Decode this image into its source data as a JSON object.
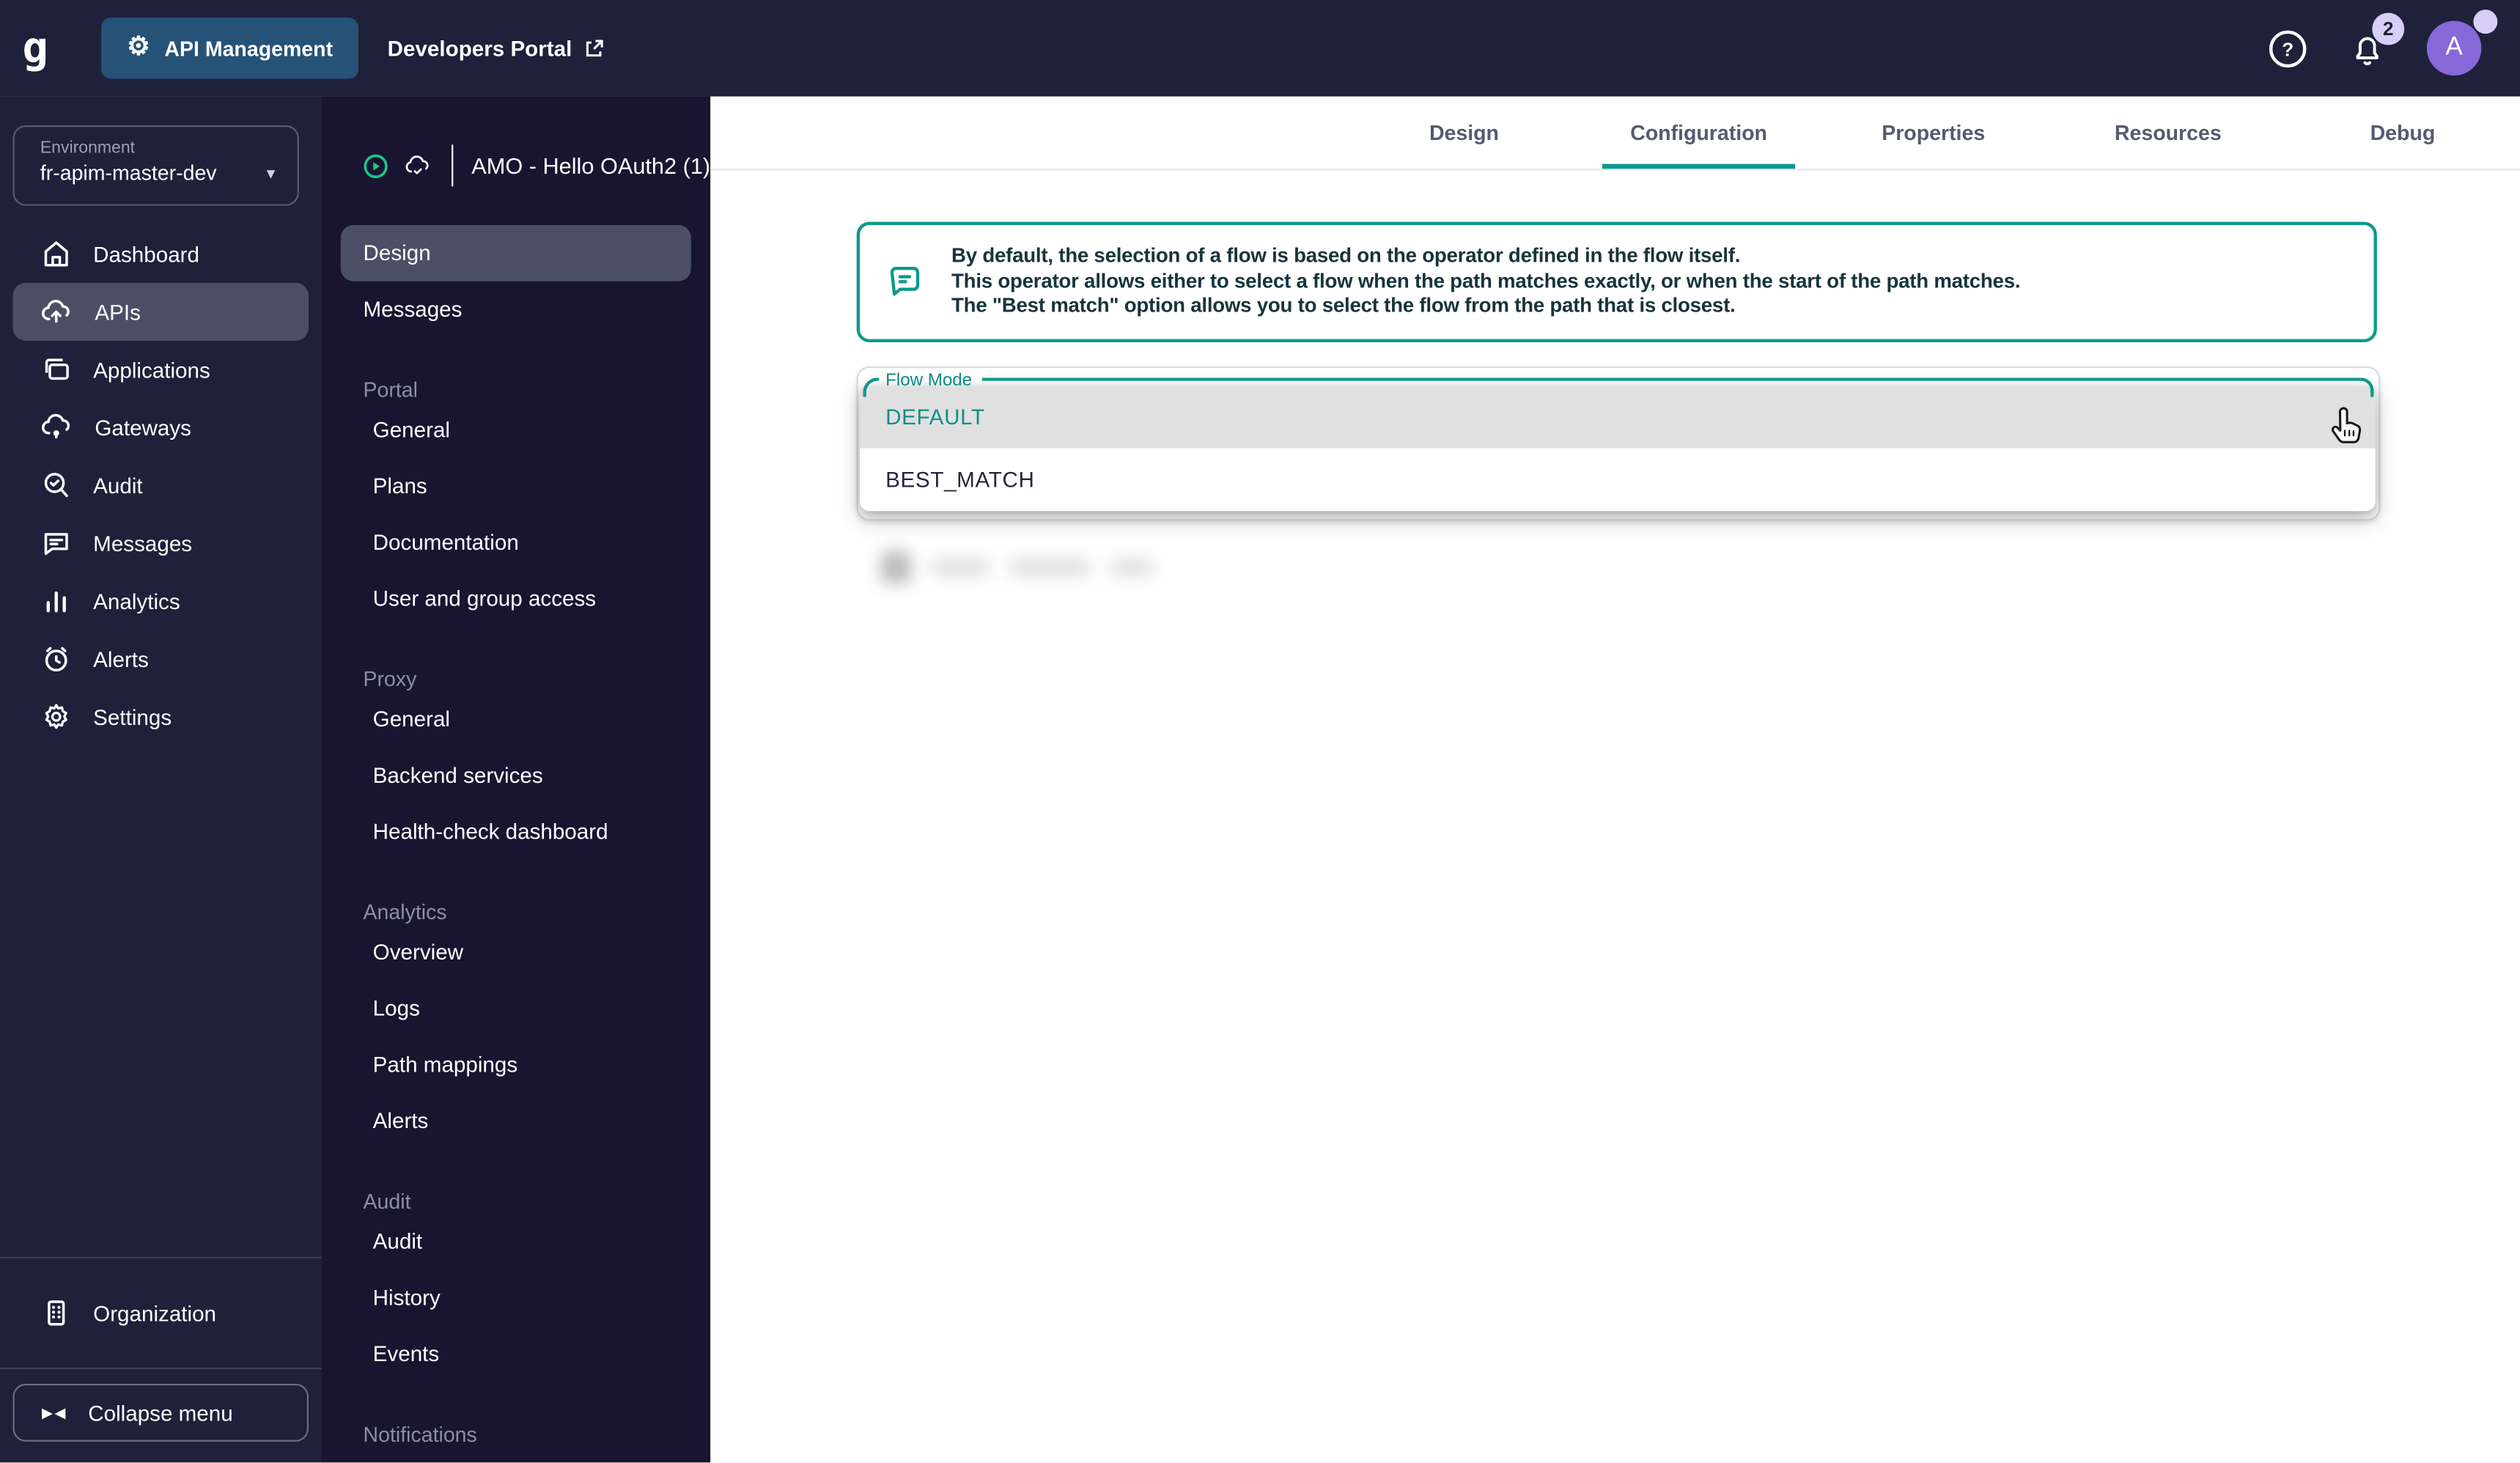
{
  "colors": {
    "accent": "#0c9a8d",
    "topbar_bg": "#1e2139",
    "sidenav_bg": "#191530",
    "selected_bg": "#4b4f66",
    "app_button_bg": "#265278",
    "avatar_bg": "#8668d9",
    "badge_bg": "#d8cff8",
    "option_highlight_bg": "#e0e0e0"
  },
  "topbar": {
    "logo": "g",
    "app_button": "API Management",
    "portal_link": "Developers Portal",
    "help_glyph": "?",
    "notifications_count": "2",
    "avatar_letter": "A"
  },
  "environment": {
    "label": "Environment",
    "value": "fr-apim-master-dev"
  },
  "sidebar": {
    "items": [
      {
        "label": "Dashboard",
        "icon": "home"
      },
      {
        "label": "APIs",
        "icon": "cloud-up",
        "selected": true
      },
      {
        "label": "Applications",
        "icon": "applications"
      },
      {
        "label": "Gateways",
        "icon": "cloud-gateway"
      },
      {
        "label": "Audit",
        "icon": "magnifier-check"
      },
      {
        "label": "Messages",
        "icon": "chat"
      },
      {
        "label": "Analytics",
        "icon": "bar-chart"
      },
      {
        "label": "Alerts",
        "icon": "alarm"
      },
      {
        "label": "Settings",
        "icon": "gear"
      }
    ],
    "organization": "Organization",
    "collapse": "Collapse menu",
    "collapse_glyph": "▶◀"
  },
  "api_menu": {
    "title": "AMO - Hello OAuth2 (1)",
    "items": [
      {
        "label": "Design",
        "selected": true
      },
      {
        "label": "Messages"
      }
    ],
    "sections": [
      {
        "header": "Portal",
        "items": [
          "General",
          "Plans",
          "Documentation",
          "User and group access"
        ]
      },
      {
        "header": "Proxy",
        "items": [
          "General",
          "Backend services",
          "Health-check dashboard"
        ]
      },
      {
        "header": "Analytics",
        "items": [
          "Overview",
          "Logs",
          "Path mappings",
          "Alerts"
        ]
      },
      {
        "header": "Audit",
        "items": [
          "Audit",
          "History",
          "Events"
        ]
      },
      {
        "header": "Notifications",
        "items": []
      }
    ]
  },
  "tabs": [
    {
      "label": "Design"
    },
    {
      "label": "Configuration",
      "active": true
    },
    {
      "label": "Properties"
    },
    {
      "label": "Resources"
    },
    {
      "label": "Debug"
    }
  ],
  "banner": {
    "line1": "By default, the selection of a flow is based on the operator defined in the flow itself.",
    "line2": "This operator allows either to select a flow when the path matches exactly, or when the start of the path matches.",
    "line3": "The \"Best match\" option allows you to select the flow from the path that is closest."
  },
  "flow_mode": {
    "label": "Flow Mode",
    "selected": "DEFAULT",
    "options": [
      "DEFAULT",
      "BEST_MATCH"
    ]
  }
}
